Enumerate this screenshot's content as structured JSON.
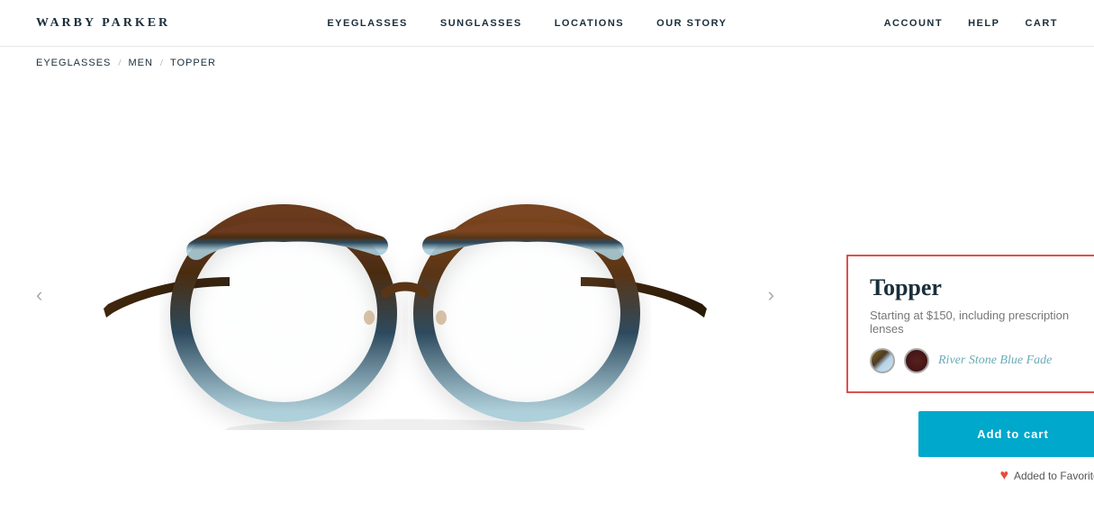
{
  "nav": {
    "logo": "WARBY PARKER",
    "links_center": [
      {
        "label": "EYEGLASSES",
        "id": "eyeglasses"
      },
      {
        "label": "SUNGLASSES",
        "id": "sunglasses"
      },
      {
        "label": "LOCATIONS",
        "id": "locations"
      },
      {
        "label": "OUR STORY",
        "id": "our-story"
      }
    ],
    "links_right": [
      {
        "label": "ACCOUNT",
        "id": "account"
      },
      {
        "label": "HELP",
        "id": "help"
      },
      {
        "label": "CART",
        "id": "cart"
      }
    ]
  },
  "breadcrumb": {
    "items": [
      {
        "label": "EYEGLASSES",
        "id": "eyeglasses"
      },
      {
        "label": "MEN",
        "id": "men"
      },
      {
        "label": "TOPPER",
        "id": "topper"
      }
    ]
  },
  "carousel": {
    "prev_label": "‹",
    "next_label": "›"
  },
  "product": {
    "name": "Topper",
    "price_text": "Starting at $150, including prescription lenses",
    "color_name": "River Stone Blue Fade",
    "add_to_cart_label": "Add to cart",
    "favorites_text": "Added to Favorites!"
  }
}
